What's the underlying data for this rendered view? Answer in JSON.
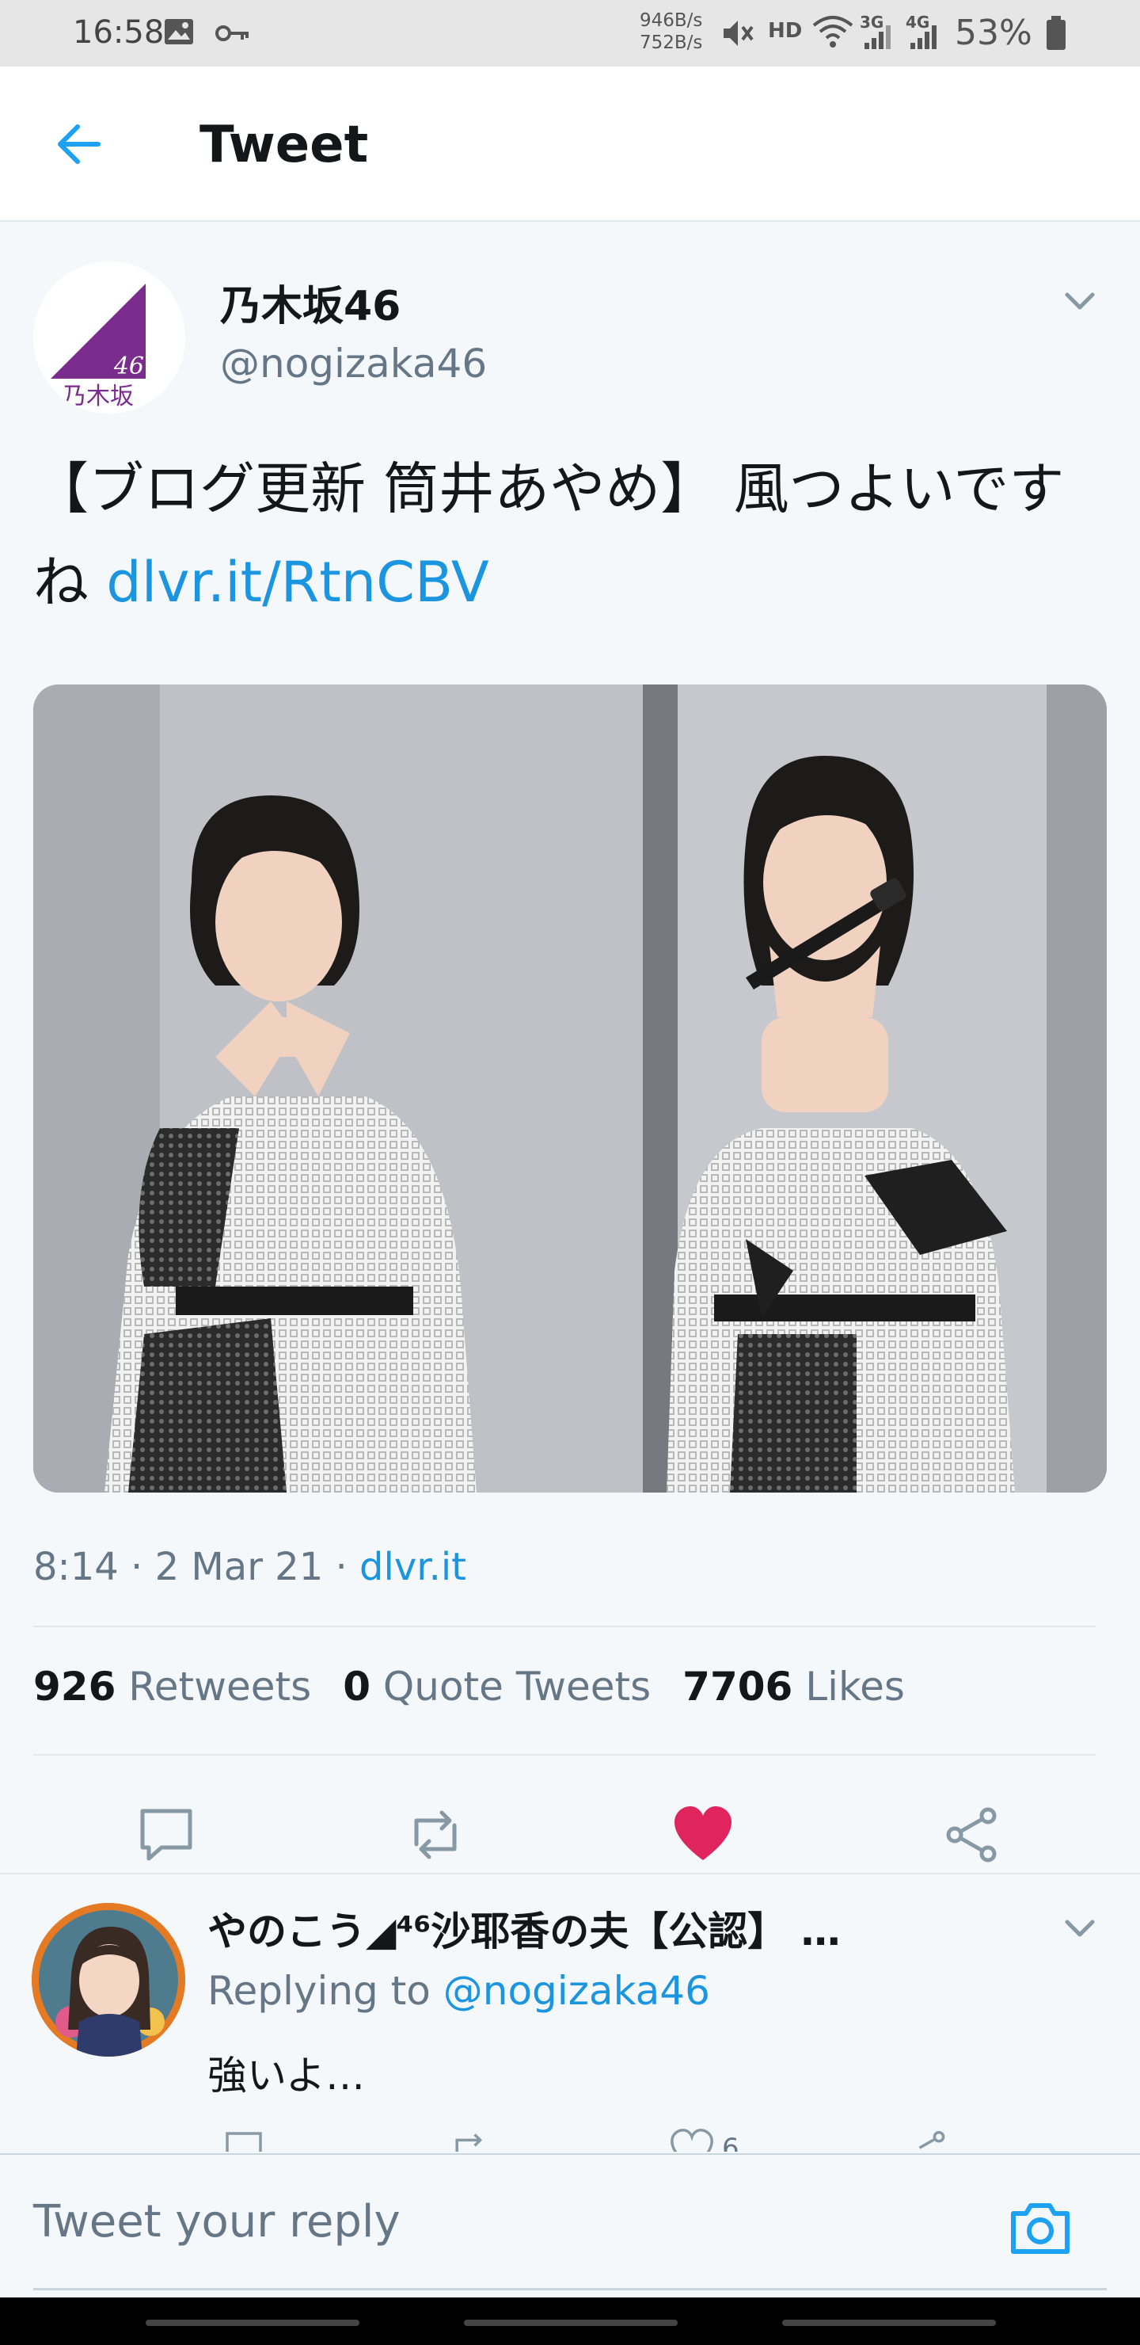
{
  "status_bar": {
    "time": "16:58",
    "net_up": "946B/s",
    "net_down": "752B/s",
    "hd_label": "HD",
    "signal_3g": "3G",
    "signal_4g": "4G",
    "battery": "53%"
  },
  "app_bar": {
    "title": "Tweet",
    "back_icon": "arrow-left-icon"
  },
  "tweet": {
    "author_name": "乃木坂46",
    "author_handle": "@nogizaka46",
    "logo_text_number": "46",
    "logo_text_kanji": "乃木坂",
    "text_main": "【ブログ更新 筒井あやめ】 風つよいですね ",
    "text_link": "dlvr.it/RtnCBV",
    "time": "8:14 · 2 Mar 21 · ",
    "source": "dlvr.it",
    "retweet_count": "926",
    "retweet_label": "Retweets",
    "quote_count": "0",
    "quote_label": "Quote Tweets",
    "like_count": "7706",
    "like_label": "Likes",
    "liked": true
  },
  "reply": {
    "author_name": "やのこう◢⁴⁶沙耶香の夫【公認】 …",
    "replying_prefix": "Replying to ",
    "replying_handle": "@nogizaka46",
    "text": "強いよ…",
    "like_count": "6"
  },
  "compose": {
    "placeholder": "Tweet your reply"
  },
  "colors": {
    "accent": "#1b95e0",
    "like": "#e0245e",
    "nogizaka_purple": "#7b2d8e",
    "muted": "#657786"
  }
}
